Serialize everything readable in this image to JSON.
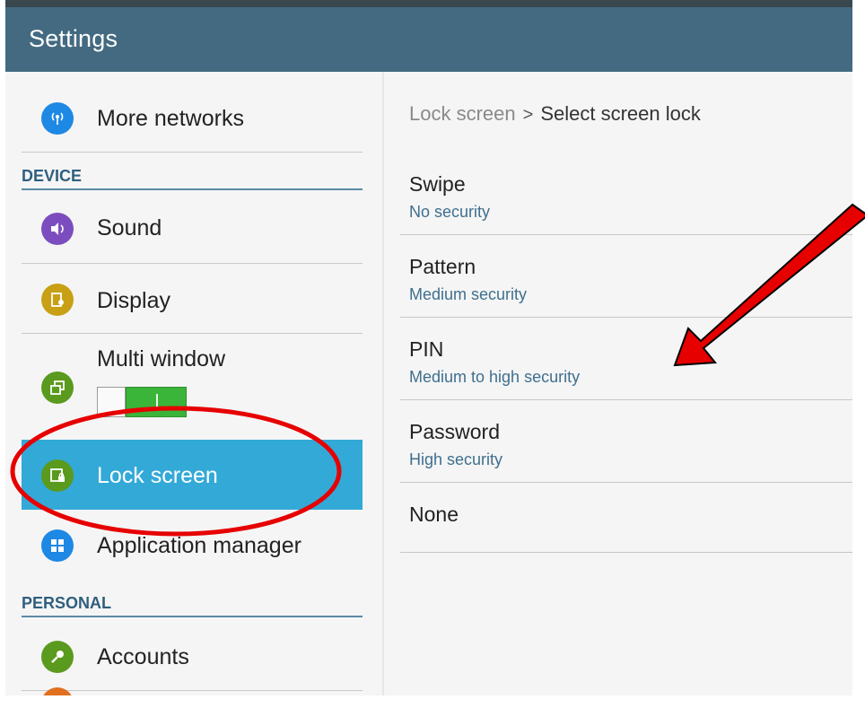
{
  "app": {
    "title": "Settings"
  },
  "sidebar": {
    "items": [
      {
        "label": "More networks",
        "icon": "antenna-icon",
        "color": "#1e88e5"
      },
      {
        "section": "DEVICE"
      },
      {
        "label": "Sound",
        "icon": "speaker-icon",
        "color": "#7c4dbe"
      },
      {
        "label": "Display",
        "icon": "display-icon",
        "color": "#c9a015"
      },
      {
        "label": "Multi window",
        "icon": "multi-window-icon",
        "color": "#5a9a1e",
        "toggle": "on"
      },
      {
        "label": "Lock screen",
        "icon": "lock-screen-icon",
        "color": "#5a9a1e",
        "selected": true
      },
      {
        "label": "Application manager",
        "icon": "grid-icon",
        "color": "#1e88e5"
      },
      {
        "section": "PERSONAL"
      },
      {
        "label": "Accounts",
        "icon": "key-icon",
        "color": "#5a9a1e"
      }
    ]
  },
  "breadcrumb": {
    "parent": "Lock screen",
    "separator": ">",
    "current": "Select screen lock"
  },
  "options": [
    {
      "title": "Swipe",
      "subtitle": "No security"
    },
    {
      "title": "Pattern",
      "subtitle": "Medium security"
    },
    {
      "title": "PIN",
      "subtitle": "Medium to high security"
    },
    {
      "title": "Password",
      "subtitle": "High security"
    },
    {
      "title": "None",
      "subtitle": ""
    }
  ],
  "colors": {
    "action_bar": "#436a80",
    "selected_row": "#33a9d8",
    "annotation": "#e60000"
  }
}
